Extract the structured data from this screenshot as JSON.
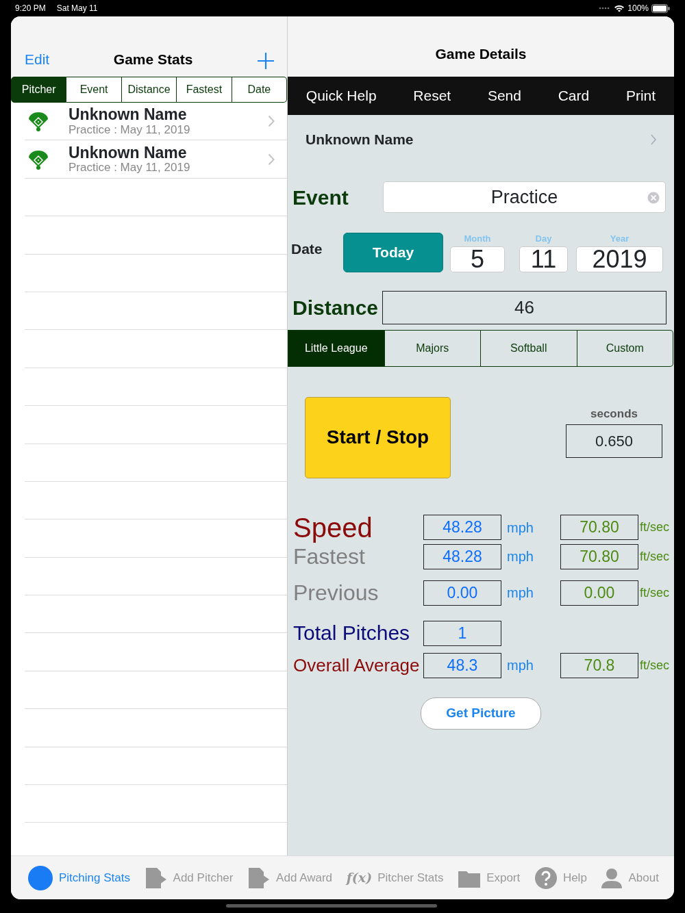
{
  "status_bar": {
    "time": "9:20 PM",
    "date": "Sat May 11",
    "battery": "100%"
  },
  "left": {
    "edit": "Edit",
    "title": "Game Stats",
    "sort_tabs": [
      {
        "label": "Pitcher",
        "selected": true
      },
      {
        "label": "Event",
        "selected": false
      },
      {
        "label": "Distance",
        "selected": false
      },
      {
        "label": "Fastest",
        "selected": false
      },
      {
        "label": "Date",
        "selected": false
      }
    ],
    "rows": [
      {
        "name": "Unknown Name",
        "detail": "Practice : May 11, 2019"
      },
      {
        "name": "Unknown Name",
        "detail": "Practice : May 11, 2019"
      }
    ]
  },
  "right": {
    "title": "Game Details",
    "toolbar": [
      "Quick Help",
      "Reset",
      "Send",
      "Card",
      "Print"
    ],
    "pitcher": "Unknown Name",
    "event_label": "Event",
    "event_value": "Practice",
    "date_label": "Date",
    "today": "Today",
    "month_label": "Month",
    "month": "5",
    "day_label": "Day",
    "day": "11",
    "year_label": "Year",
    "year": "2019",
    "distance_label": "Distance",
    "distance": "46",
    "leagues": [
      {
        "label": "Little League",
        "selected": true
      },
      {
        "label": "Majors",
        "selected": false
      },
      {
        "label": "Softball",
        "selected": false
      },
      {
        "label": "Custom",
        "selected": false
      }
    ],
    "start_stop": "Start / Stop",
    "seconds_label": "seconds",
    "seconds": "0.650",
    "stats": [
      {
        "kind": "speed",
        "label": "Speed",
        "mph": "48.28",
        "mph_unit": "mph",
        "fps": "70.80",
        "fps_unit": "ft/sec"
      },
      {
        "kind": "fastest",
        "label": "Fastest",
        "mph": "48.28",
        "mph_unit": "mph",
        "fps": "70.80",
        "fps_unit": "ft/sec"
      },
      {
        "kind": "previous",
        "label": "Previous",
        "mph": "0.00",
        "mph_unit": "mph",
        "fps": "0.00",
        "fps_unit": "ft/sec"
      },
      {
        "kind": "total",
        "label": "Total Pitches",
        "mph": "1"
      },
      {
        "kind": "average",
        "label": "Overall Average",
        "mph": "48.3",
        "mph_unit": "mph",
        "fps": "70.8",
        "fps_unit": "ft/sec"
      }
    ],
    "get_picture": "Get Picture"
  },
  "tab_bar": [
    {
      "kind": "circle",
      "label": "Pitching Stats",
      "selected": true
    },
    {
      "kind": "doc",
      "label": "Add Pitcher",
      "selected": false
    },
    {
      "kind": "doc",
      "label": "Add Award",
      "selected": false
    },
    {
      "kind": "glyph",
      "glyph": "f(x)",
      "label": "Pitcher Stats",
      "selected": false
    },
    {
      "kind": "folder",
      "label": "Export",
      "selected": false
    },
    {
      "kind": "help",
      "label": "Help",
      "selected": false
    },
    {
      "kind": "person",
      "label": "About",
      "selected": false
    }
  ]
}
